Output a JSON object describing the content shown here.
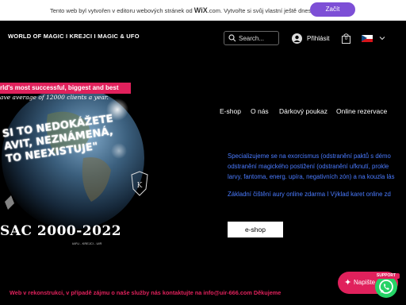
{
  "wix_banner": {
    "message_prefix": "Tento web byl vytvořen v editoru webových stránek od",
    "brand": "WiX",
    "brand_suffix": ".com.",
    "message_suffix": "Vytvořte si svůj vlastní ještě dnes.",
    "cta_label": "Začít",
    "cta_color": "#7d4fd6"
  },
  "header": {
    "site_title": "WORLD OF MAGIC I KREJCI I MAGIC & UFO",
    "search_placeholder": "Search...",
    "login_label": "Přihlásit",
    "cart_count": "0",
    "language": "cs"
  },
  "hero": {
    "banner_top": "rld's most successful, biggest and best",
    "banner_sub": "ave average of 12000 clients a year.",
    "line1": "SI TO NEDOKÁŽETE",
    "line2": "AVIT, NEZNÁMENÁ,",
    "line3": "TO NEEXISTUJE\"",
    "years": "SAC 2000-2022",
    "tagline": "IAFU - KREJCI - UIR",
    "accent": "#e0215c"
  },
  "nav": {
    "items": [
      "E-shop",
      "O nás",
      "Dárkový poukaz",
      "Online rezervace"
    ]
  },
  "content": {
    "lines": [
      "Specializujeme se na exorcismus (odstranění paktů s démo",
      "odstranění magického postižení (odstranění uřknutí, prokle",
      "larvy, fantoma, energ. upíra, negativních zón) a na kouzla lás"
    ],
    "subline": "Základní čištění aury online zdarma  I  Výklad karet online zd",
    "text_color": "#4a7bff",
    "button_label": "e-shop"
  },
  "footer": {
    "message": "Web v rekonstrukci, v případě zájmu o naše služby nás kontaktujte na info@uir-666.com Děkujeme"
  },
  "widgets": {
    "chat_label": "Napište",
    "support_label": "SUPPORT",
    "whatsapp_color": "#25d366"
  }
}
